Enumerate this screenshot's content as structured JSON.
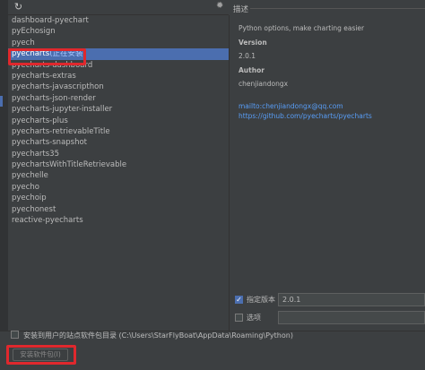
{
  "toolbar": {
    "refresh_icon": "refresh-icon",
    "spinner_icon": "loading-spinner-icon"
  },
  "packages": [
    {
      "name": "dashboard-pyechart",
      "status": ""
    },
    {
      "name": "pyEchosign",
      "status": ""
    },
    {
      "name": "pyech",
      "status": ""
    },
    {
      "name": "pyecharts",
      "status": "(正在安装)"
    },
    {
      "name": "pyecharts-dashboard",
      "status": ""
    },
    {
      "name": "pyecharts-extras",
      "status": ""
    },
    {
      "name": "pyecharts-javascripthon",
      "status": ""
    },
    {
      "name": "pyecharts-json-render",
      "status": ""
    },
    {
      "name": "pyecharts-jupyter-installer",
      "status": ""
    },
    {
      "name": "pyecharts-plus",
      "status": ""
    },
    {
      "name": "pyecharts-retrievableTitle",
      "status": ""
    },
    {
      "name": "pyecharts-snapshot",
      "status": ""
    },
    {
      "name": "pyecharts35",
      "status": ""
    },
    {
      "name": "pyechartsWithTitleRetrievable",
      "status": ""
    },
    {
      "name": "pyechelle",
      "status": ""
    },
    {
      "name": "pyecho",
      "status": ""
    },
    {
      "name": "pyechoip",
      "status": ""
    },
    {
      "name": "pyechonest",
      "status": ""
    },
    {
      "name": "reactive-pyecharts",
      "status": ""
    }
  ],
  "description": {
    "header": "描述",
    "summary": "Python options, make charting easier",
    "version_label": "Version",
    "version_value": "2.0.1",
    "author_label": "Author",
    "author_value": "chenjiandongx",
    "link_email": "mailto:chenjiandongx@qq.com",
    "link_repo": "https://github.com/pyecharts/pyecharts"
  },
  "options": {
    "specify_version_label": "指定版本",
    "specify_version_checked": true,
    "specify_version_value": "2.0.1",
    "options_label": "选项",
    "options_checked": false,
    "options_value": ""
  },
  "footer": {
    "user_site_label": "安装到用户的站点软件包目录 (C:\\Users\\StarFlyBoat\\AppData\\Roaming\\Python)",
    "user_site_checked": false,
    "install_button_label": "安装软件包(I)"
  }
}
